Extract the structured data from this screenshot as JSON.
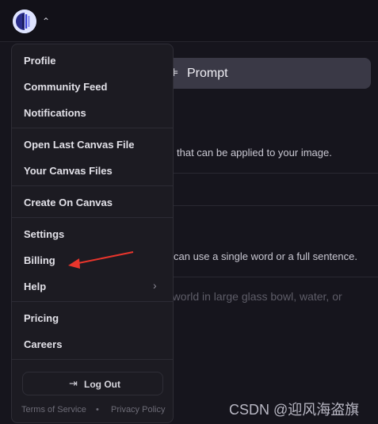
{
  "prompt_tab": {
    "icon": "sparkle-icon",
    "label": "Prompt"
  },
  "background": {
    "line1": "that can be applied to your image.",
    "line2": "can use a single word or a full sentence.",
    "placeholder": "e world in large glass bowl, water, or"
  },
  "menu": {
    "group1": [
      "Profile",
      "Community Feed",
      "Notifications"
    ],
    "group2": [
      "Open Last Canvas File",
      "Your Canvas Files"
    ],
    "group3": [
      "Create On Canvas"
    ],
    "group4": [
      "Settings",
      "Billing",
      "Help"
    ],
    "group5": [
      "Pricing",
      "Careers"
    ],
    "logout": "Log Out",
    "terms": "Terms of Service",
    "dot": "•",
    "privacy": "Privacy Policy"
  },
  "watermark": "CSDN @迎风海盗旗",
  "colors": {
    "arrow": "#e8352c",
    "accent_logo": "#4a4fe0"
  }
}
